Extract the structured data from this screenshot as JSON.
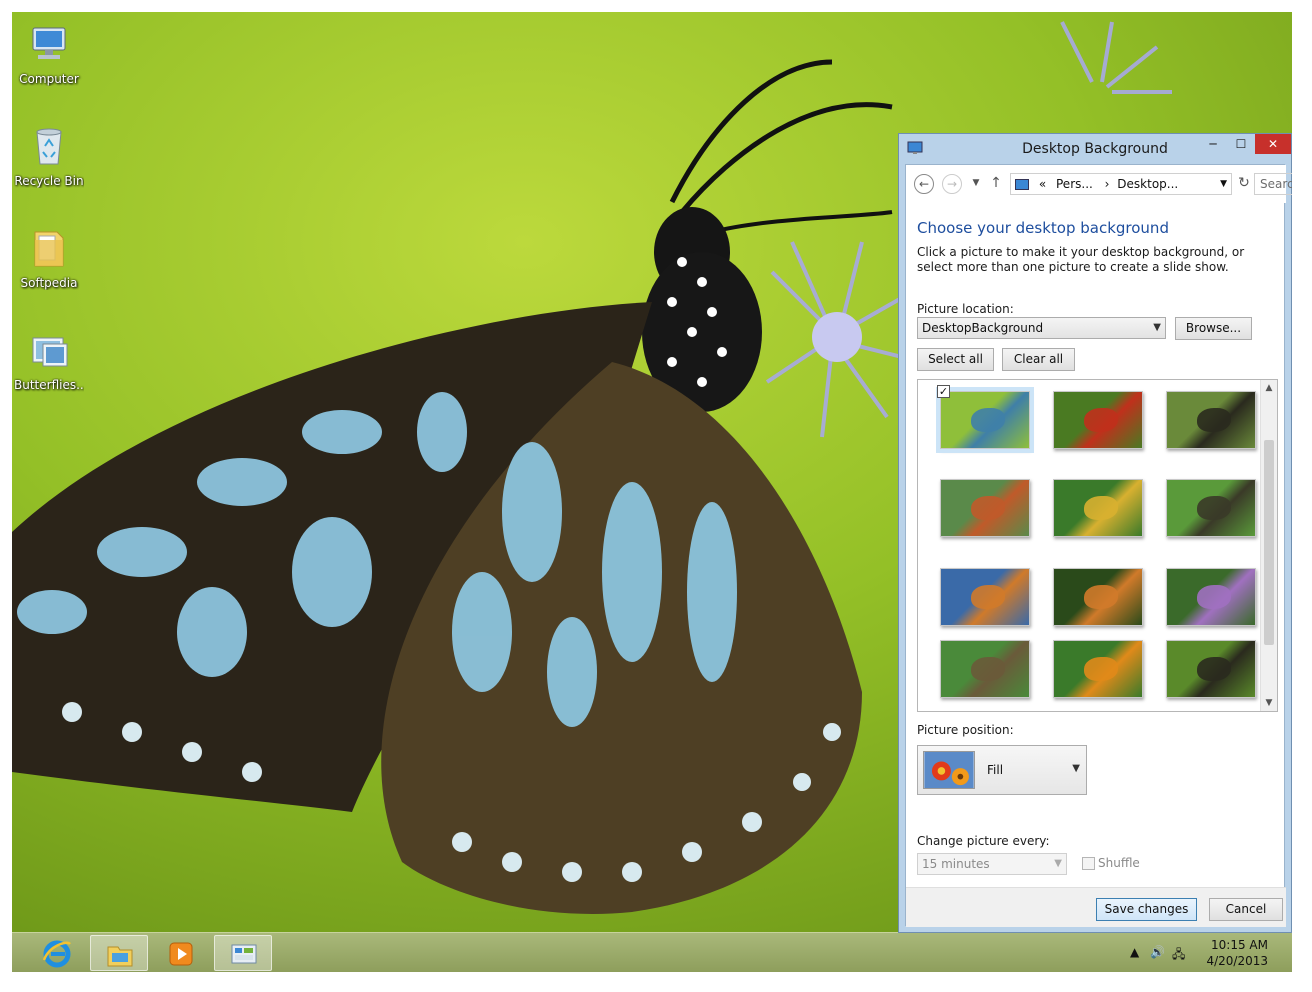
{
  "desktop": {
    "icons": [
      {
        "label": "Computer",
        "icon": "computer-icon"
      },
      {
        "label": "Recycle Bin",
        "icon": "recycle-bin-icon"
      },
      {
        "label": "Softpedia",
        "icon": "folder-icon"
      },
      {
        "label": "Butterflies...",
        "icon": "theme-pack-icon"
      }
    ]
  },
  "taskbar": {
    "items": [
      {
        "icon": "internet-explorer-icon",
        "active": false
      },
      {
        "icon": "file-explorer-icon",
        "active": true
      },
      {
        "icon": "media-player-icon",
        "active": false
      },
      {
        "icon": "control-panel-icon",
        "active": true
      }
    ],
    "tray": {
      "icons": [
        "show-hidden-icons-icon",
        "volume-icon",
        "network-icon"
      ],
      "time": "10:15 AM",
      "date": "4/20/2013"
    }
  },
  "dialog": {
    "title": "Desktop Background",
    "window_controls": {
      "minimize": "─",
      "maximize": "☐",
      "close": "✕"
    },
    "breadcrumb": {
      "prefix": "«",
      "crumbs": [
        "Pers...",
        "Desktop..."
      ],
      "separator": "›"
    },
    "search_placeholder": "Search",
    "heading": "Choose your desktop background",
    "description": "Click a picture to make it your desktop background, or select more than one picture to create a slide show.",
    "picture_location_label": "Picture location:",
    "picture_location_value": "DesktopBackground",
    "browse_label": "Browse...",
    "select_all_label": "Select all",
    "clear_all_label": "Clear all",
    "gallery": {
      "thumbnails": [
        {
          "name": "blue-tiger-butterfly",
          "selected": true,
          "colors": [
            "#3f7fa8",
            "#8fbf3a"
          ]
        },
        {
          "name": "monarch-on-red-flower",
          "selected": false,
          "colors": [
            "#c0301c",
            "#4a7a22"
          ]
        },
        {
          "name": "swallowtail-dark",
          "selected": false,
          "colors": [
            "#2a2a1e",
            "#6a8a3a"
          ]
        },
        {
          "name": "painted-lady",
          "selected": false,
          "colors": [
            "#c05a2a",
            "#5a8a4a"
          ]
        },
        {
          "name": "pansy-butterfly",
          "selected": false,
          "colors": [
            "#d8b030",
            "#3a7a2a"
          ]
        },
        {
          "name": "swallowtail-orange-flowers",
          "selected": false,
          "colors": [
            "#3a3a28",
            "#5a9a3a"
          ]
        },
        {
          "name": "colorful-wings",
          "selected": false,
          "colors": [
            "#d07a2a",
            "#3a6aa8"
          ]
        },
        {
          "name": "peacock-pansy",
          "selected": false,
          "colors": [
            "#d07a2a",
            "#2a4a1a"
          ]
        },
        {
          "name": "dark-on-purple-flower",
          "selected": false,
          "colors": [
            "#a070c0",
            "#3a6a2a"
          ]
        },
        {
          "name": "owl-butterfly",
          "selected": false,
          "colors": [
            "#6a5a3a",
            "#4a8a3a"
          ]
        },
        {
          "name": "dark-on-orange-flower",
          "selected": false,
          "colors": [
            "#e08a1a",
            "#3a7a2a"
          ]
        },
        {
          "name": "swallowtail-green",
          "selected": false,
          "colors": [
            "#2a2a1e",
            "#5a8a2a"
          ]
        }
      ]
    },
    "picture_position_label": "Picture position:",
    "picture_position_value": "Fill",
    "change_picture_label": "Change picture every:",
    "change_picture_value": "15 minutes",
    "shuffle_label": "Shuffle",
    "save_label": "Save changes",
    "cancel_label": "Cancel"
  },
  "colors": {
    "accent_blue": "#1e4e9e",
    "close_red": "#c7302b",
    "window_frame": "#b9d2e9"
  }
}
